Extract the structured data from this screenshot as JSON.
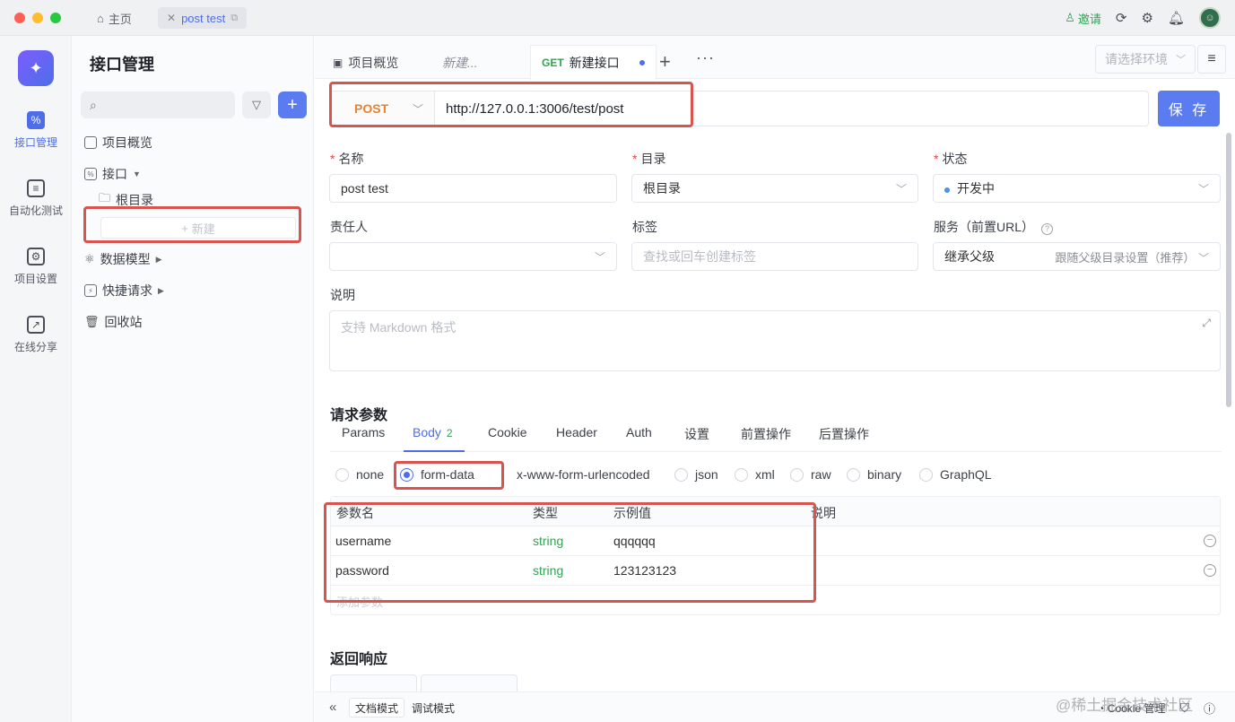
{
  "titlebar": {
    "home_tab": "主页",
    "doc_tab": "post test",
    "invite": "邀请"
  },
  "rail": {
    "items": [
      {
        "label": "接口管理",
        "icon": "api-icon",
        "active": true
      },
      {
        "label": "自动化测试",
        "icon": "automation-icon"
      },
      {
        "label": "项目设置",
        "icon": "project-settings-icon"
      },
      {
        "label": "在线分享",
        "icon": "share-icon"
      }
    ]
  },
  "nav": {
    "title": "接口管理",
    "search_placeholder": "",
    "items": {
      "overview": "项目概览",
      "apis": "接口",
      "root_dir": "根目录",
      "new": "新建",
      "schemas": "数据模型",
      "quick_requests": "快捷请求",
      "trash": "回收站"
    }
  },
  "main": {
    "tabs": {
      "overview": "项目概览",
      "new_draft": "新建...",
      "active_method": "GET",
      "active_label": "新建接口"
    },
    "env_placeholder": "请选择环境",
    "request": {
      "method": "POST",
      "url": "http://127.0.0.1:3006/test/post",
      "save": "保 存"
    },
    "form": {
      "name_label": "名称",
      "name_value": "post test",
      "dir_label": "目录",
      "dir_value": "根目录",
      "status_label": "状态",
      "status_value": "开发中",
      "owner_label": "责任人",
      "owner_value": "",
      "tags_label": "标签",
      "tags_placeholder": "查找或回车创建标签",
      "service_label": "服务（前置URL）",
      "service_value": "继承父级",
      "service_hint": "跟随父级目录设置（推荐）",
      "desc_label": "说明",
      "desc_placeholder": "支持 Markdown 格式"
    },
    "params": {
      "title": "请求参数",
      "tabs": [
        "Params",
        "Body",
        "Cookie",
        "Header",
        "Auth",
        "设置",
        "前置操作",
        "后置操作"
      ],
      "body_count": "2",
      "body_types": [
        "none",
        "form-data",
        "x-www-form-urlencoded",
        "json",
        "xml",
        "raw",
        "binary",
        "GraphQL"
      ],
      "selected_body_type": "form-data",
      "columns": [
        "参数名",
        "类型",
        "示例值",
        "说明"
      ],
      "rows": [
        {
          "name": "username",
          "type": "string",
          "example": "qqqqqq",
          "desc": ""
        },
        {
          "name": "password",
          "type": "string",
          "example": "123123123",
          "desc": ""
        }
      ],
      "add_param": "添加参数"
    },
    "response": {
      "title": "返回响应"
    },
    "bottom": {
      "doc_mode": "文档模式",
      "debug_mode": "调试模式",
      "cookie_mgmt": "Cookie 管理",
      "watermark": "@稀土掘金技术社区"
    }
  },
  "colors": {
    "accent": "#5b7cf0",
    "post_method": "#e8822c",
    "get_method": "#31a354",
    "annotation_red": "#d9534f"
  }
}
